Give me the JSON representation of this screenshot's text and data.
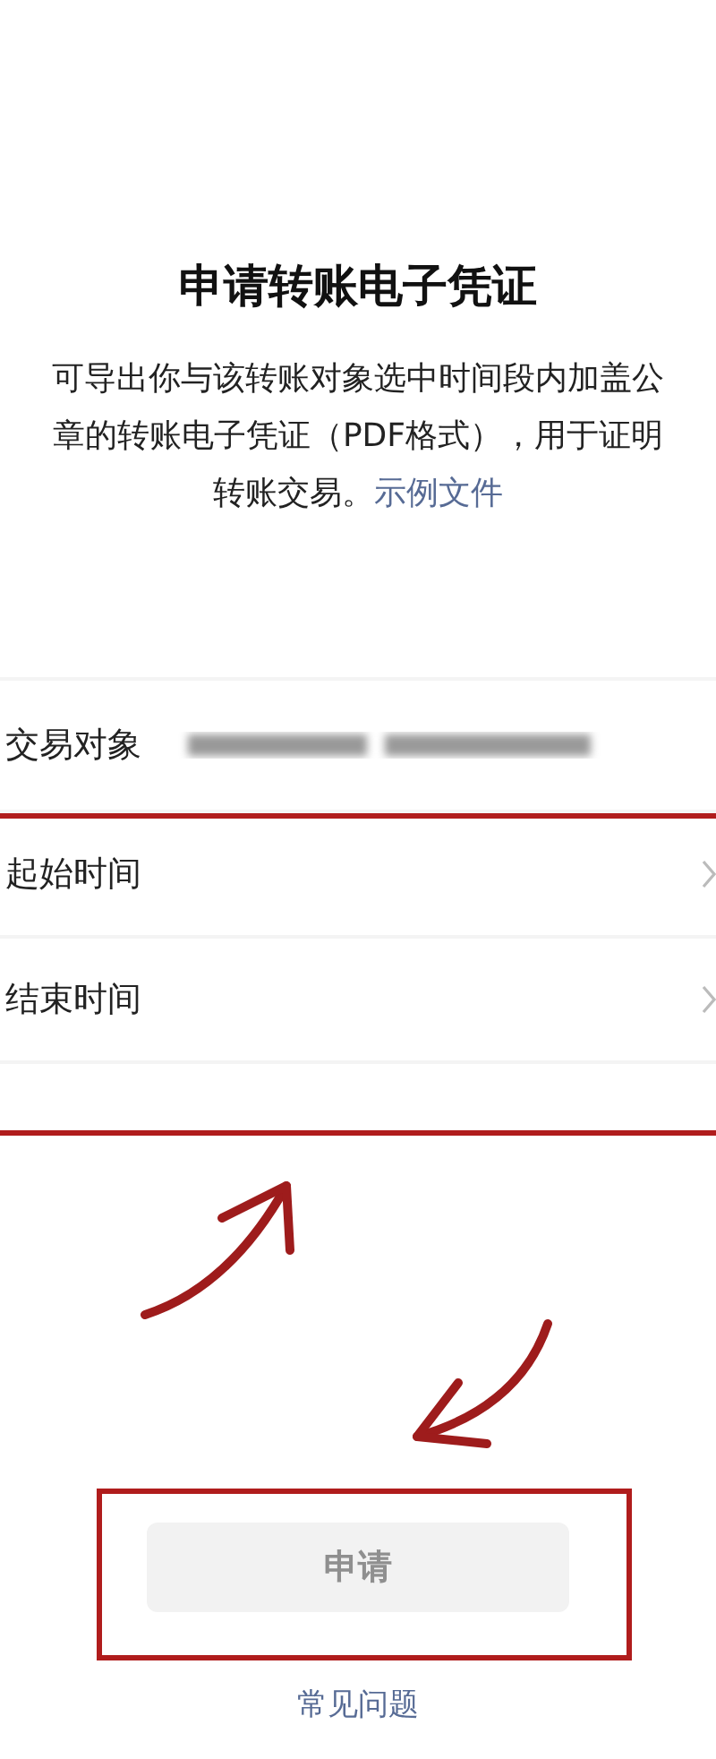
{
  "title": "申请转账电子凭证",
  "description": {
    "lines": [
      "可导出你与该转账对象选中时间段内加盖公",
      "章的转账电子凭证（PDF格式），用于证明",
      "转账交易。"
    ],
    "link": "示例文件"
  },
  "fields": [
    {
      "kind": "redacted",
      "label": "交易对象"
    },
    {
      "kind": "picker",
      "label": "起始时间"
    },
    {
      "kind": "picker",
      "label": "结束时间"
    },
    {
      "kind": "empty"
    }
  ],
  "submit": {
    "label": "申请",
    "disabled": true
  },
  "faq_link": "常见问题"
}
